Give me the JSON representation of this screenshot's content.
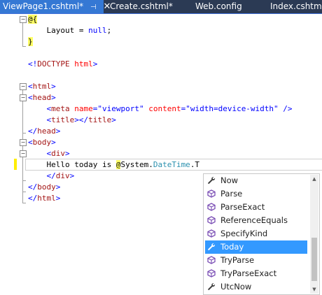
{
  "tabs": [
    {
      "label": "ViewPage1.cshtml*",
      "active": true,
      "pin_glyph": "⊣",
      "close_glyph": "✕"
    },
    {
      "label": "Create.cshtml*",
      "active": false
    },
    {
      "label": "Web.config",
      "active": false
    },
    {
      "label": "Index.cshtml",
      "active": false
    }
  ],
  "code": {
    "l1_razor": "@{",
    "l2_a": "    Layout = ",
    "l2_kw": "null",
    "l2_b": ";",
    "l3_razor": "}",
    "l5_a": "<!",
    "l5_tag": "DOCTYPE",
    "l5_b": " ",
    "l5_attr": "html",
    "l5_c": ">",
    "l7_open": "<",
    "l7_tag": "html",
    "l7_close": ">",
    "l8_open": "<",
    "l8_tag": "head",
    "l8_close": ">",
    "l9_open": "    <",
    "l9_tag": "meta",
    "l9_sp": " ",
    "l9_attr1": "name",
    "l9_eq1": "=",
    "l9_val1": "\"viewport\"",
    "l9_sp2": " ",
    "l9_attr2": "content",
    "l9_eq2": "=",
    "l9_val2": "\"width=device-width\"",
    "l9_end": " />",
    "l10_open": "    <",
    "l10_tag": "title",
    "l10_mid": "></",
    "l10_tag2": "title",
    "l10_close": ">",
    "l11_open": "</",
    "l11_tag": "head",
    "l11_close": ">",
    "l12_open": "<",
    "l12_tag": "body",
    "l12_close": ">",
    "l13_open": "    <",
    "l13_tag": "div",
    "l13_close": ">",
    "l14_text": "    Hello today is ",
    "l14_at": "@",
    "l14_sys": "System.",
    "l14_type": "DateTime",
    "l14_rest": ".T",
    "l15_open": "    </",
    "l15_tag": "div",
    "l15_close": ">",
    "l16_open": "</",
    "l16_tag": "body",
    "l16_close": ">",
    "l17_open": "</",
    "l17_tag": "html",
    "l17_close": ">"
  },
  "outline": {
    "collapse_glyph": "−"
  },
  "completion": {
    "items": [
      {
        "label": "Now",
        "icon": "wrench-icon",
        "glyph": "🔧",
        "kind": "property",
        "selected": false
      },
      {
        "label": "Parse",
        "icon": "method-cube-icon",
        "glyph": "⬢",
        "kind": "method",
        "selected": false
      },
      {
        "label": "ParseExact",
        "icon": "method-cube-icon",
        "glyph": "⬢",
        "kind": "method",
        "selected": false
      },
      {
        "label": "ReferenceEquals",
        "icon": "method-cube-icon",
        "glyph": "⬢",
        "kind": "method",
        "selected": false
      },
      {
        "label": "SpecifyKind",
        "icon": "method-cube-icon",
        "glyph": "⬢",
        "kind": "method",
        "selected": false
      },
      {
        "label": "Today",
        "icon": "wrench-icon",
        "glyph": "🔧",
        "kind": "property",
        "selected": true
      },
      {
        "label": "TryParse",
        "icon": "method-cube-icon",
        "glyph": "⬢",
        "kind": "method",
        "selected": false
      },
      {
        "label": "TryParseExact",
        "icon": "method-cube-icon",
        "glyph": "⬢",
        "kind": "method",
        "selected": false
      },
      {
        "label": "UtcNow",
        "icon": "wrench-icon",
        "glyph": "🔧",
        "kind": "property",
        "selected": false
      }
    ],
    "scroll_up_glyph": "▲",
    "scroll_down_glyph": "▼"
  },
  "colors": {
    "tab_bar": "#2b3a54",
    "tab_active": "#3578d4",
    "selection": "#3399ff",
    "razor_highlight": "#ffff66",
    "change_marker": "#ffee00"
  }
}
